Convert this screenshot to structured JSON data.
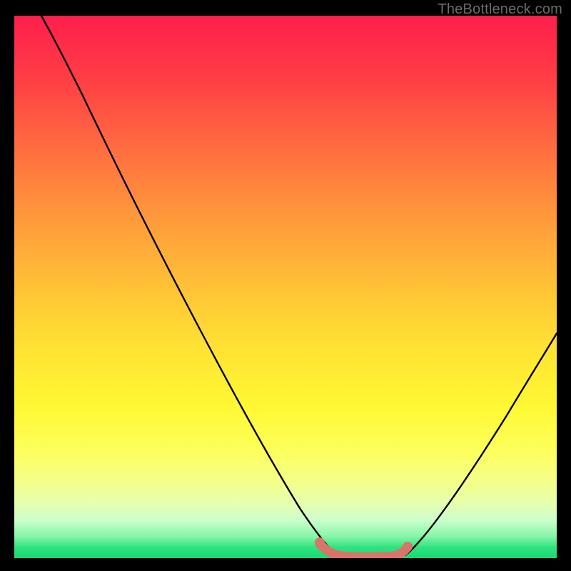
{
  "attribution": "TheBottleneck.com",
  "colors": {
    "background": "#000000",
    "curve": "#000000",
    "highlight": "#d9746a",
    "gradient_top": "#ff1e4b",
    "gradient_bottom": "#18d977"
  },
  "chart_data": {
    "type": "line",
    "title": "",
    "xlabel": "",
    "ylabel": "",
    "xlim": [
      0,
      100
    ],
    "ylim": [
      0,
      100
    ],
    "series": [
      {
        "name": "left-branch",
        "x": [
          5,
          10,
          15,
          20,
          25,
          30,
          35,
          40,
          45,
          50,
          53,
          56,
          59
        ],
        "y": [
          100,
          92,
          82.5,
          73,
          63,
          53,
          43,
          33,
          23,
          13,
          7,
          3,
          0.8
        ]
      },
      {
        "name": "right-branch",
        "x": [
          72,
          76,
          80,
          84,
          88,
          92,
          96,
          100
        ],
        "y": [
          0.5,
          3,
          7,
          12,
          18,
          24.5,
          31.5,
          39
        ]
      },
      {
        "name": "highlight-segment",
        "x": [
          56,
          59,
          61,
          63,
          65,
          67,
          69,
          71,
          72
        ],
        "y": [
          2.2,
          0.9,
          0.4,
          0.15,
          0.05,
          0.1,
          0.25,
          0.6,
          1.4
        ]
      }
    ]
  }
}
